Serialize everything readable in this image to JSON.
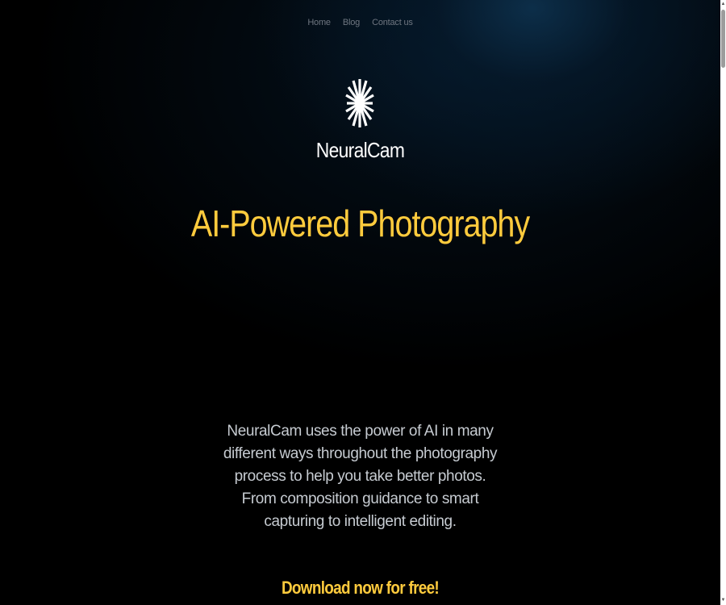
{
  "nav": {
    "items": [
      {
        "label": "Home"
      },
      {
        "label": "Blog"
      },
      {
        "label": "Contact us"
      }
    ]
  },
  "brand": {
    "icon": "starburst-icon",
    "name": "NeuralCam"
  },
  "hero": {
    "headline": "AI-Powered Photography",
    "description": "NeuralCam uses the power of AI in many different ways throughout the photography process to help you take better photos. From composition guidance to smart capturing to intelligent editing.",
    "cta": "Download now for free!"
  },
  "colors": {
    "accent": "#ffcb3d",
    "background": "#000000",
    "glow": "#0e3452",
    "nav_text": "#6f7680",
    "body_text": "#c6cbd1"
  }
}
